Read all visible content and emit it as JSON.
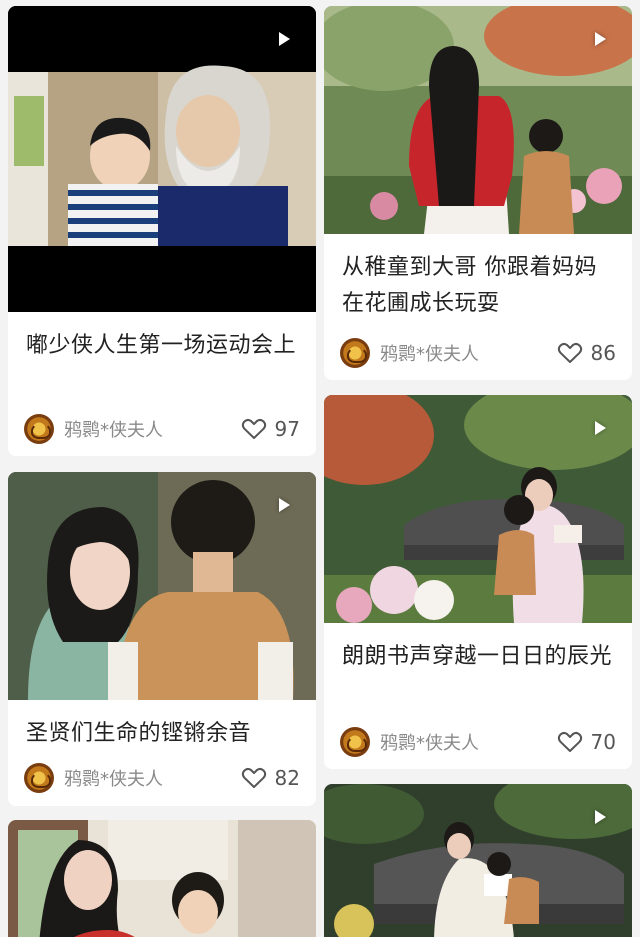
{
  "cards": [
    {
      "title": "嘟少侠人生第一场运动会上",
      "author": "鸦鹮*侠夫人",
      "likes": "97",
      "icons": [
        "play-icon",
        "heart-icon"
      ]
    },
    {
      "title": "从稚童到大哥 你跟着妈妈在花圃成长玩耍",
      "author": "鸦鹮*侠夫人",
      "likes": "86",
      "icons": [
        "play-icon",
        "heart-icon"
      ]
    },
    {
      "title": "圣贤们生命的铿锵余音",
      "author": "鸦鹮*侠夫人",
      "likes": "82",
      "icons": [
        "play-icon",
        "heart-icon"
      ]
    },
    {
      "title": "朗朗书声穿越一日日的辰光",
      "author": "鸦鹮*侠夫人",
      "likes": "70",
      "icons": [
        "play-icon",
        "heart-icon"
      ]
    },
    {
      "title": "",
      "author": "",
      "likes": "",
      "icons": []
    },
    {
      "title": "",
      "author": "",
      "likes": "",
      "icons": [
        "play-icon"
      ]
    }
  ],
  "colors": {
    "background": "#f3f3f3",
    "card": "#ffffff",
    "title_text": "#222222",
    "author_text": "#8a8a8a",
    "likes_text": "#555555"
  }
}
